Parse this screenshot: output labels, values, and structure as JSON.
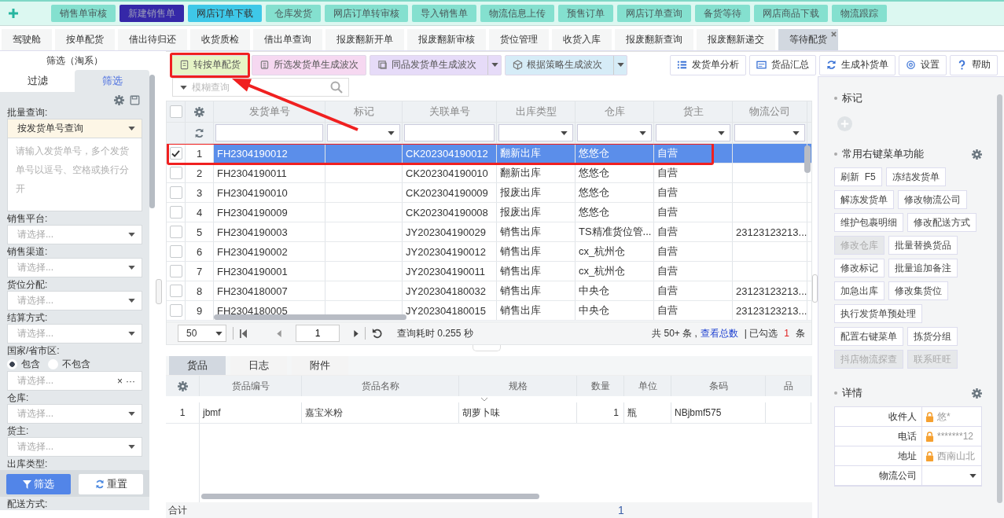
{
  "top_nav": [
    {
      "label": "销售单审核",
      "kind": "normal"
    },
    {
      "label": "新建销售单",
      "kind": "current"
    },
    {
      "label": "网店订单下载",
      "kind": "hover"
    },
    {
      "label": "仓库发货",
      "kind": "normal"
    },
    {
      "label": "网店订单转审核",
      "kind": "normal"
    },
    {
      "label": "导入销售单",
      "kind": "normal"
    },
    {
      "label": "物流信息上传",
      "kind": "normal"
    },
    {
      "label": "预售订单",
      "kind": "normal"
    },
    {
      "label": "网店订单查询",
      "kind": "normal"
    },
    {
      "label": "备货等待",
      "kind": "normal"
    },
    {
      "label": "网店商品下载",
      "kind": "normal"
    },
    {
      "label": "物流跟踪",
      "kind": "normal"
    }
  ],
  "tabs": [
    {
      "label": "驾驶舱",
      "selected": false,
      "closable": false
    },
    {
      "label": "按单配货",
      "selected": false,
      "closable": false
    },
    {
      "label": "借出待归还",
      "selected": false,
      "closable": false
    },
    {
      "label": "收货质检",
      "selected": false,
      "closable": false
    },
    {
      "label": "借出单查询",
      "selected": false,
      "closable": false
    },
    {
      "label": "报废翻新开单",
      "selected": false,
      "closable": false
    },
    {
      "label": "报废翻新审核",
      "selected": false,
      "closable": false
    },
    {
      "label": "货位管理",
      "selected": false,
      "closable": false
    },
    {
      "label": "收货入库",
      "selected": false,
      "closable": false
    },
    {
      "label": "报废翻新查询",
      "selected": false,
      "closable": false
    },
    {
      "label": "报废翻新递交",
      "selected": false,
      "closable": false
    },
    {
      "label": "等待配货",
      "selected": true,
      "closable": true
    }
  ],
  "filter_panel": {
    "title": "筛选（淘系）",
    "tabs": [
      {
        "label": "过滤",
        "selected": false
      },
      {
        "label": "筛选",
        "selected": true
      }
    ],
    "batch_query": {
      "label": "批量查询:",
      "mode": "按发货单号查询",
      "placeholder": "请输入发货单号，多个发货单号以逗号、空格或换行分开"
    },
    "fields": [
      {
        "label": "销售平台:",
        "kind": "select",
        "placeholder": "请选择..."
      },
      {
        "label": "销售渠道:",
        "kind": "select",
        "placeholder": "请选择..."
      },
      {
        "label": "货位分配:",
        "kind": "select",
        "placeholder": "请选择..."
      },
      {
        "label": "结算方式:",
        "kind": "select",
        "placeholder": "请选择..."
      },
      {
        "label": "国家/省市区:",
        "kind": "region",
        "placeholder": "请选择...",
        "options": [
          {
            "label": "包含",
            "selected": true
          },
          {
            "label": "不包含",
            "selected": false
          }
        ],
        "clear": "×",
        "more": "···"
      },
      {
        "label": "仓库:",
        "kind": "select",
        "placeholder": "请选择..."
      },
      {
        "label": "货主:",
        "kind": "select",
        "placeholder": "请选择..."
      },
      {
        "label": "出库类型:",
        "kind": "label"
      }
    ],
    "buttons": [
      {
        "label": "筛选",
        "kind": "primary"
      },
      {
        "label": "重置",
        "kind": "reset"
      }
    ],
    "trailing_label": "配送方式:"
  },
  "toolbar": {
    "left": [
      {
        "label": "转按单配货",
        "color": "#e6f5c6",
        "dropdown": false,
        "highlighted": true
      },
      {
        "label": "所选发货单生成波次",
        "color": "#f6d8f1",
        "dropdown": false,
        "highlighted": false
      },
      {
        "label": "同品发货单生成波次",
        "color": "#e6dbf8",
        "dropdown": true,
        "highlighted": false
      },
      {
        "label": "根据策略生成波次",
        "color": "#d6ecf7",
        "dropdown": true,
        "highlighted": false
      }
    ],
    "right": [
      {
        "label": "发货单分析"
      },
      {
        "label": "货品汇总"
      },
      {
        "label": "生成补货单"
      },
      {
        "label": "设置"
      },
      {
        "label": "帮助"
      }
    ]
  },
  "search": {
    "placeholder": "模糊查询"
  },
  "table": {
    "all_checked": false,
    "columns": [
      {
        "label": "发货单号",
        "kind": "text"
      },
      {
        "label": "标记",
        "kind": "select"
      },
      {
        "label": "关联单号",
        "kind": "text"
      },
      {
        "label": "出库类型",
        "kind": "select"
      },
      {
        "label": "仓库",
        "kind": "select"
      },
      {
        "label": "货主",
        "kind": "select"
      },
      {
        "label": "物流公司",
        "kind": "select"
      }
    ],
    "rows": [
      {
        "no": "1",
        "cells": [
          "FH2304190012",
          "",
          "CK202304190012",
          "翻新出库",
          "悠悠仓",
          "自营",
          ""
        ],
        "checked": true,
        "selected": true,
        "highlighted": true
      },
      {
        "no": "2",
        "cells": [
          "FH2304190011",
          "",
          "CK202304190010",
          "翻新出库",
          "悠悠仓",
          "自营",
          ""
        ],
        "checked": false,
        "selected": false,
        "highlighted": false
      },
      {
        "no": "3",
        "cells": [
          "FH2304190010",
          "",
          "CK202304190009",
          "报废出库",
          "悠悠仓",
          "自营",
          ""
        ],
        "checked": false,
        "selected": false,
        "highlighted": false
      },
      {
        "no": "4",
        "cells": [
          "FH2304190009",
          "",
          "CK202304190008",
          "报废出库",
          "悠悠仓",
          "自营",
          ""
        ],
        "checked": false,
        "selected": false,
        "highlighted": false
      },
      {
        "no": "5",
        "cells": [
          "FH2304190003",
          "",
          "JY202304190029",
          "销售出库",
          "TS精准货位管...",
          "自营",
          "23123123213..."
        ],
        "checked": false,
        "selected": false,
        "highlighted": false
      },
      {
        "no": "6",
        "cells": [
          "FH2304190002",
          "",
          "JY202304190012",
          "销售出库",
          "cx_杭州仓",
          "自营",
          ""
        ],
        "checked": false,
        "selected": false,
        "highlighted": false
      },
      {
        "no": "7",
        "cells": [
          "FH2304190001",
          "",
          "JY202304190011",
          "销售出库",
          "cx_杭州仓",
          "自营",
          ""
        ],
        "checked": false,
        "selected": false,
        "highlighted": false
      },
      {
        "no": "8",
        "cells": [
          "FH2304180007",
          "",
          "JY202304180032",
          "销售出库",
          "中央仓",
          "自营",
          "23123123213..."
        ],
        "checked": false,
        "selected": false,
        "highlighted": false
      },
      {
        "no": "9",
        "cells": [
          "FH2304180005",
          "",
          "JY202304180015",
          "销售出库",
          "中央仓",
          "自营",
          "23123123213..."
        ],
        "checked": false,
        "selected": false,
        "highlighted": false
      }
    ]
  },
  "pager": {
    "page_size": "50",
    "page": "1",
    "timing": "查询耗时 0.255 秒",
    "total": "共 50+ 条 ,",
    "total_link": "查看总数",
    "checked_prefix": "| 已勾选",
    "checked_count": "1",
    "checked_suffix": "条"
  },
  "detail_tabs": [
    {
      "label": "货品",
      "selected": true
    },
    {
      "label": "日志",
      "selected": false
    },
    {
      "label": "附件",
      "selected": false
    }
  ],
  "goods": {
    "columns": [
      "货品编号",
      "货品名称",
      "规格",
      "数量",
      "单位",
      "条码",
      "品"
    ],
    "rows": [
      {
        "no": "1",
        "cells": [
          "jbmf",
          "嘉宝米粉",
          "胡萝卜味",
          "1",
          "瓶",
          "NBjbmf575",
          ""
        ]
      }
    ],
    "total_label": "合计",
    "total_value": "1"
  },
  "side_panel": {
    "mark_title": "标记",
    "menu_title": "常用右键菜单功能",
    "menu_buttons": [
      {
        "label": "刷新  F5",
        "disabled": false
      },
      {
        "label": "冻结发货单",
        "disabled": false
      },
      {
        "label": "解冻发货单",
        "disabled": false
      },
      {
        "label": "修改物流公司",
        "disabled": false
      },
      {
        "label": "维护包裹明细",
        "disabled": false
      },
      {
        "label": "修改配送方式",
        "disabled": false
      },
      {
        "label": "修改仓库",
        "disabled": true
      },
      {
        "label": "批量替换货品",
        "disabled": false
      },
      {
        "label": "修改标记",
        "disabled": false
      },
      {
        "label": "批量追加备注",
        "disabled": false
      },
      {
        "label": "加急出库",
        "disabled": false
      },
      {
        "label": "修改集货位",
        "disabled": false
      },
      {
        "label": "执行发货单预处理",
        "disabled": false
      },
      {
        "label": "配置右键菜单",
        "disabled": false
      },
      {
        "label": "拣货分组",
        "disabled": false
      },
      {
        "label": "抖店物流探查",
        "disabled": true
      },
      {
        "label": "联系旺旺",
        "disabled": true
      }
    ],
    "detail_title": "详情",
    "details": [
      {
        "label": "收件人",
        "value": "悠*",
        "kind": "locked"
      },
      {
        "label": "电话",
        "value": "*******12",
        "kind": "locked"
      },
      {
        "label": "地址",
        "value": "西南山北",
        "kind": "locked"
      },
      {
        "label": "物流公司",
        "kind": "select"
      }
    ]
  }
}
